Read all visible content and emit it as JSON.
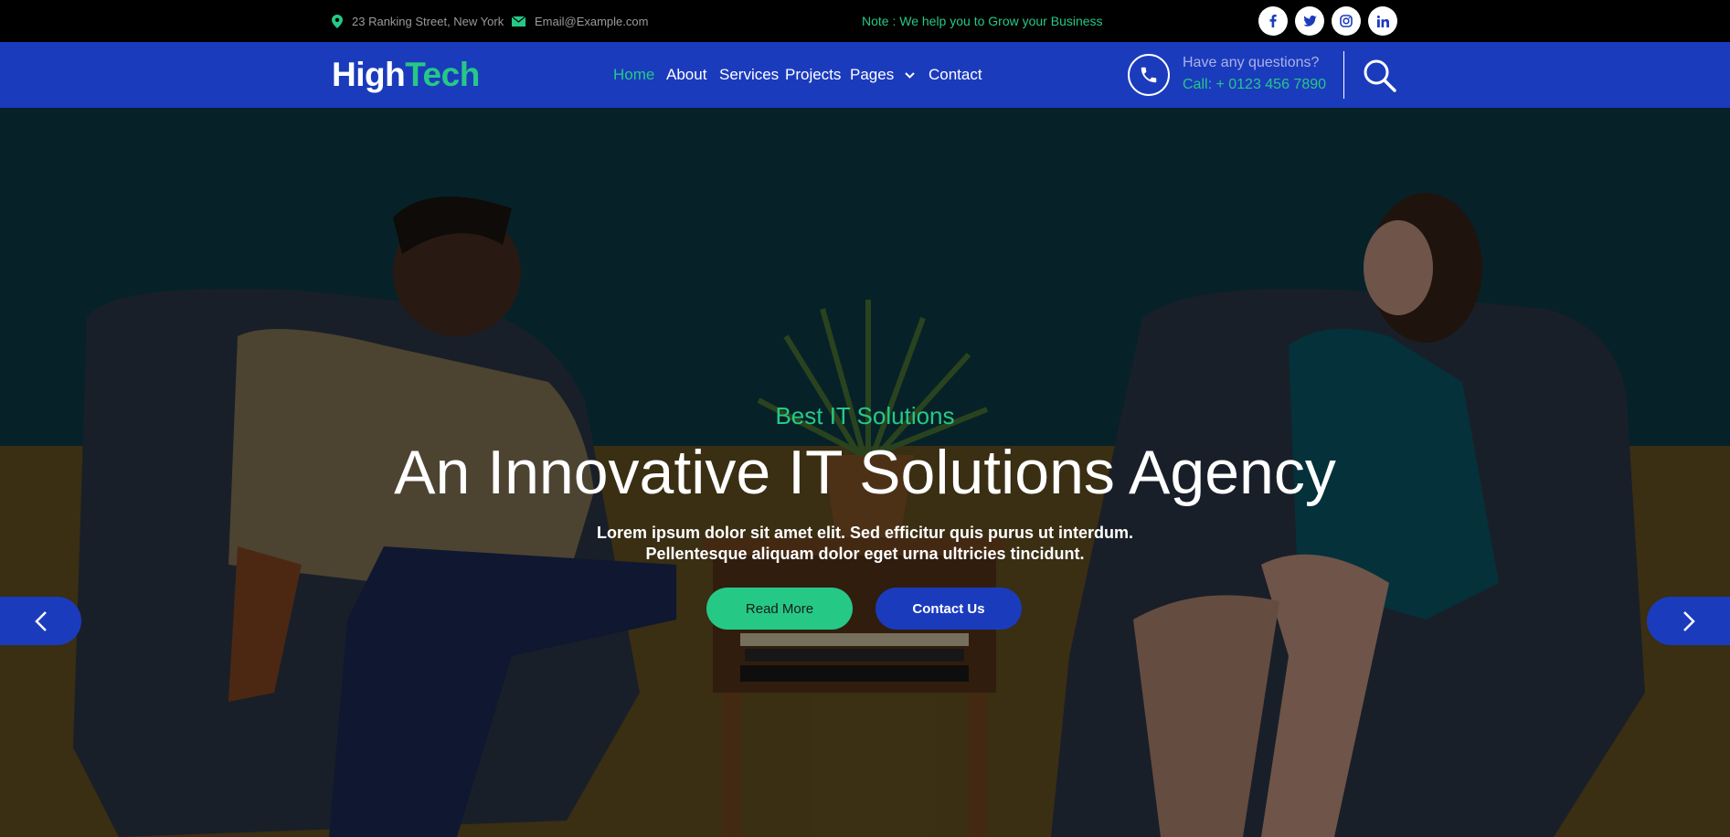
{
  "topbar": {
    "address": "23 Ranking Street, New York",
    "email": "Email@Example.com",
    "note": "Note : We help you to Grow your Business",
    "socials": [
      "facebook-icon",
      "twitter-icon",
      "instagram-icon",
      "linkedin-icon"
    ]
  },
  "navbar": {
    "logo_part1": "High",
    "logo_part2": "Tech",
    "links": [
      "Home",
      "About",
      "Services",
      "Projects",
      "Pages",
      "Contact"
    ],
    "active": "Home",
    "questions": "Have any questions?",
    "phone": "Call: + 0123 456 7890"
  },
  "hero": {
    "subtitle": "Best IT Solutions",
    "title": "An Innovative IT Solutions Agency",
    "desc_line1": "Lorem ipsum dolor sit amet elit. Sed efficitur quis purus ut interdum.",
    "desc_line2": "Pellentesque aliquam dolor eget urna ultricies tincidunt.",
    "btn_read": "Read More",
    "btn_contact": "Contact Us"
  },
  "colors": {
    "brand_blue": "#1b3bbd",
    "accent_green": "#25c985",
    "topbar_bg": "#000000"
  }
}
